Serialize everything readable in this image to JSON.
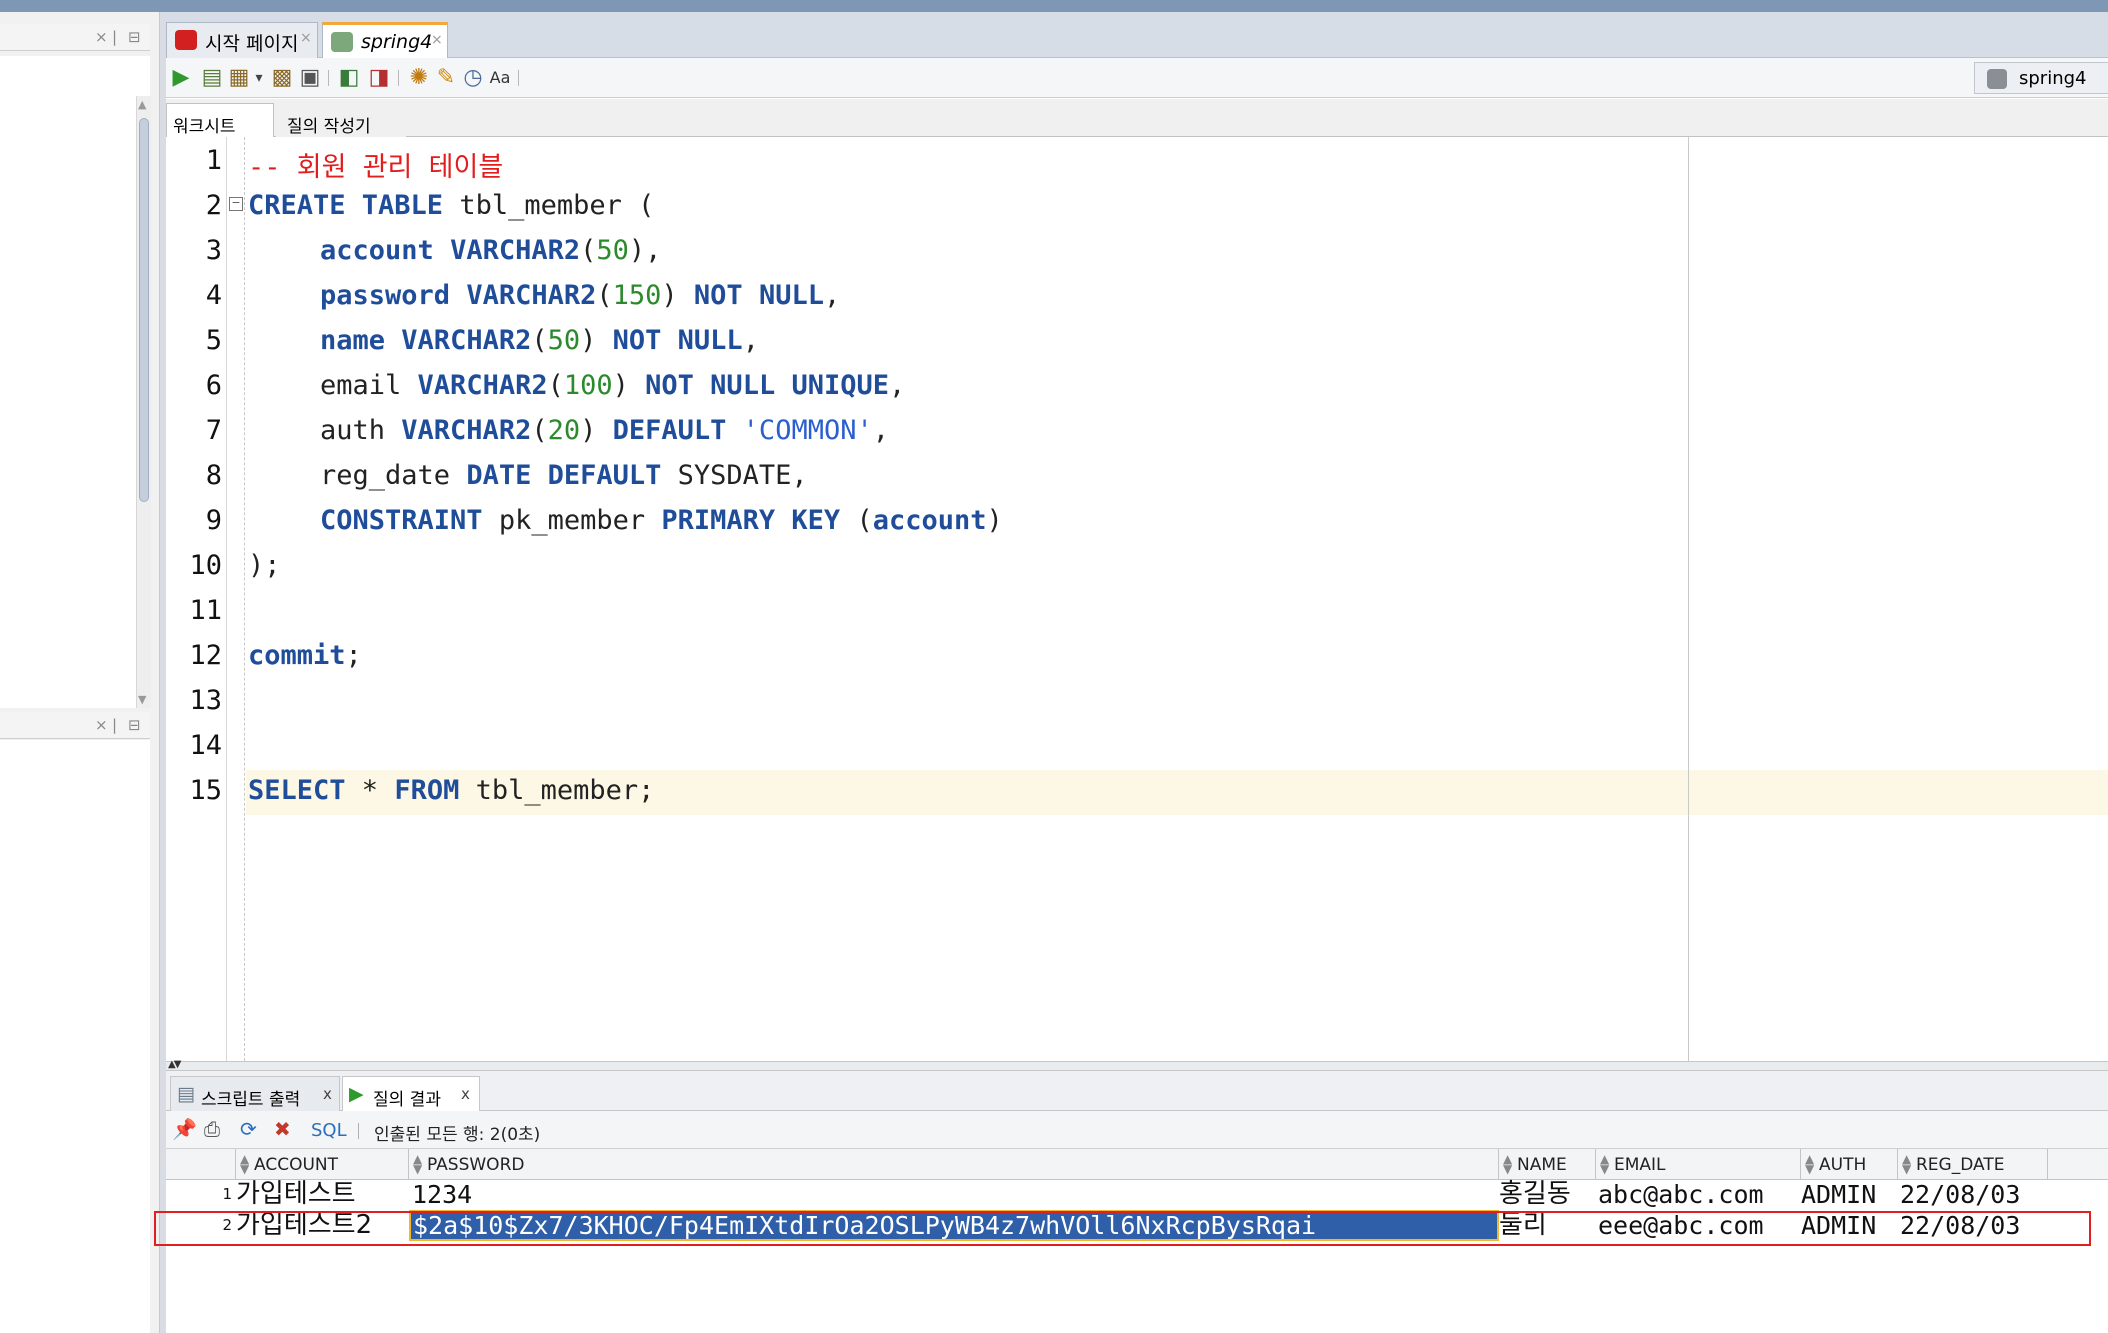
{
  "doc_tabs": [
    {
      "label": "시작 페이지"
    },
    {
      "label": "spring4"
    }
  ],
  "connection": {
    "label": "spring4"
  },
  "sub_tabs": [
    {
      "label": "워크시트"
    },
    {
      "label": "질의 작성기"
    }
  ],
  "editor": {
    "line_numbers": [
      "1",
      "2",
      "3",
      "4",
      "5",
      "6",
      "7",
      "8",
      "9",
      "10",
      "11",
      "12",
      "13",
      "14",
      "15"
    ],
    "lines": {
      "l1": "-- 회원 관리 테이블",
      "l2_kw": "CREATE TABLE",
      "l2_rest": " tbl_member (",
      "l3_col": "account",
      "l3_type": "VARCHAR2",
      "l3_open": "(",
      "l3_num": "50",
      "l3_close": "),",
      "l4_col": "password",
      "l4_type": "VARCHAR2",
      "l4_open": "(",
      "l4_num": "150",
      "l4_close": ") ",
      "l4_kw": "NOT NULL",
      "l4_end": ",",
      "l5_col": "name",
      "l5_type": "VARCHAR2",
      "l5_open": "(",
      "l5_num": "50",
      "l5_close": ") ",
      "l5_kw": "NOT NULL",
      "l5_end": ",",
      "l6_col": "email ",
      "l6_type": "VARCHAR2",
      "l6_open": "(",
      "l6_num": "100",
      "l6_close": ") ",
      "l6_kw": "NOT NULL UNIQUE",
      "l6_end": ",",
      "l7_col": "auth ",
      "l7_type": "VARCHAR2",
      "l7_open": "(",
      "l7_num": "20",
      "l7_close": ") ",
      "l7_kw": "DEFAULT",
      "l7_str": " 'COMMON'",
      "l7_end": ",",
      "l8_col": "reg_date ",
      "l8_kw": "DATE DEFAULT",
      "l8_rest": " SYSDATE,",
      "l9_kw": "CONSTRAINT",
      "l9_mid": " pk_member ",
      "l9_kw2": "PRIMARY KEY",
      "l9_open": " (",
      "l9_col": "account",
      "l9_close": ")",
      "l10": ");",
      "l12_kw": "commit",
      "l12_end": ";",
      "l15_kw": "SELECT",
      "l15_mid": " * ",
      "l15_kw2": "FROM",
      "l15_rest": " tbl_member;"
    }
  },
  "result_tabs": [
    {
      "label": "스크립트 출력"
    },
    {
      "label": "질의 결과"
    }
  ],
  "result_toolbar": {
    "sql_label": "SQL",
    "row_count": "인출된 모든 행: 2(0초)"
  },
  "grid": {
    "columns": [
      "ACCOUNT",
      "PASSWORD",
      "NAME",
      "EMAIL",
      "AUTH",
      "REG_DATE"
    ],
    "rows": [
      {
        "num": "1",
        "account": "가입테스트",
        "password": "1234",
        "name": "홍길동",
        "email": "abc@abc.com",
        "auth": "ADMIN",
        "reg_date": "22/08/03"
      },
      {
        "num": "2",
        "account": "가입테스트2",
        "password": "$2a$10$Zx7/3KHOC/Fp4EmIXtdIrOa2OSLPyWB4z7whVOll6NxRcpBysRqai",
        "name": "둘리",
        "email": "eee@abc.com",
        "auth": "ADMIN",
        "reg_date": "22/08/03"
      }
    ]
  },
  "colors": {
    "keyword": "#1f4d9a",
    "comment": "#e21d1d",
    "number": "#2b8a2b",
    "string": "#2b5fcf",
    "selection": "#2f5fa8",
    "highlight_box": "#e02020"
  }
}
